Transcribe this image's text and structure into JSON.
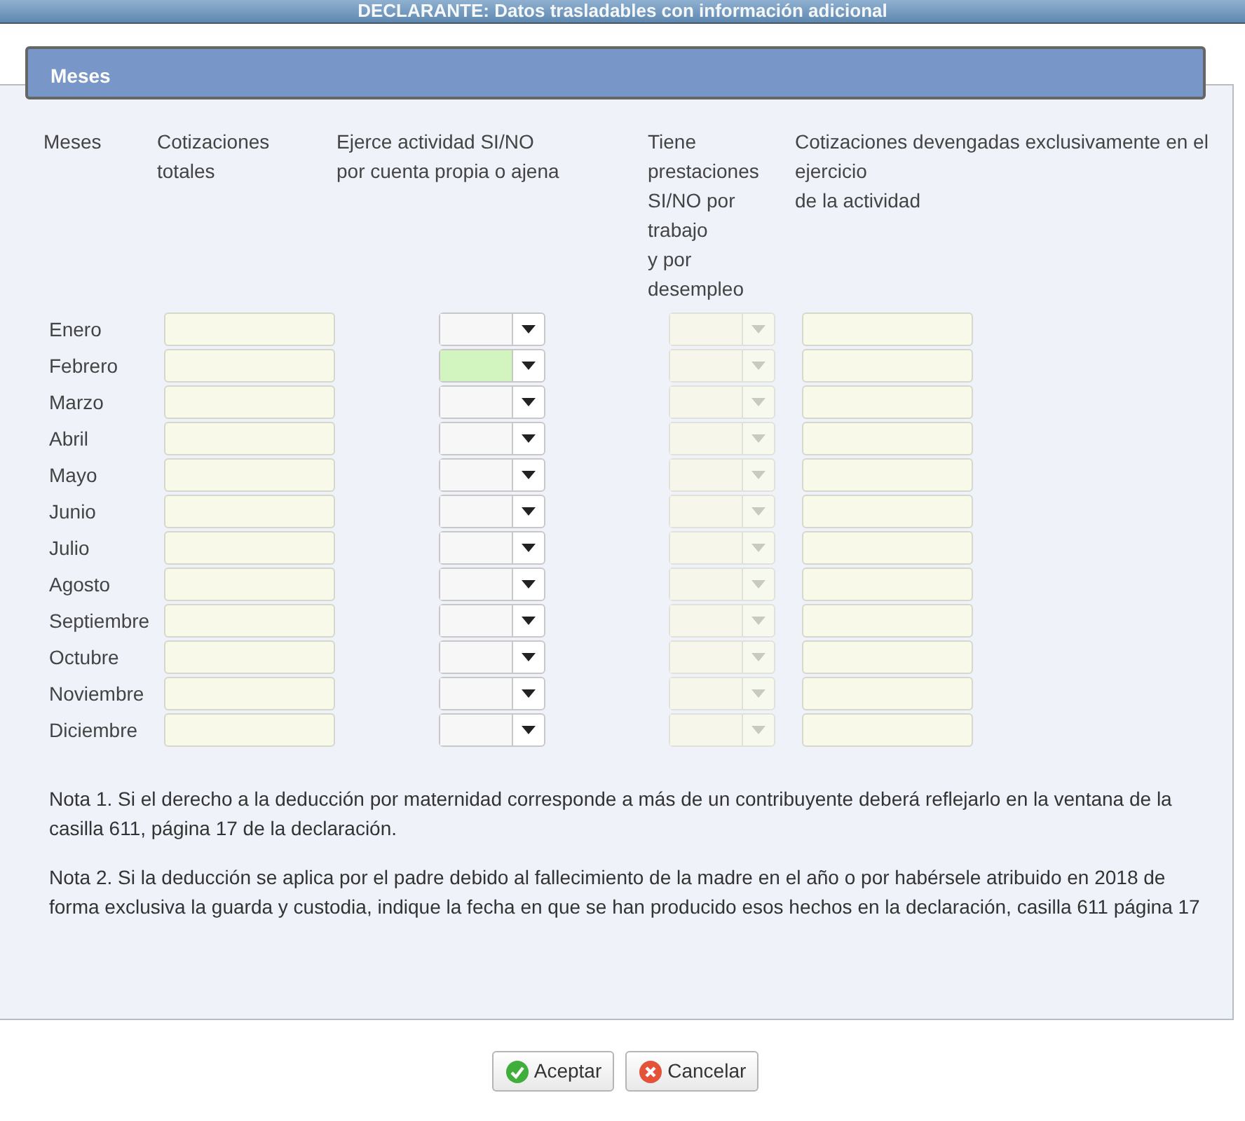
{
  "dialog": {
    "title": "DECLARANTE: Datos trasladables con información adicional"
  },
  "section": {
    "title": "Meses"
  },
  "columns": [
    "Meses",
    "Cotizaciones totales",
    "Ejerce actividad SI/NO\npor cuenta propia o ajena",
    "Tiene prestaciones SI/NO por trabajo\ny por desempleo",
    "Cotizaciones devengadas exclusivamente en el ejercicio\nde la actividad"
  ],
  "rows": [
    {
      "month": "Enero",
      "activity_highlighted": false,
      "benefits_disabled": true
    },
    {
      "month": "Febrero",
      "activity_highlighted": true,
      "benefits_disabled": true
    },
    {
      "month": "Marzo",
      "activity_highlighted": false,
      "benefits_disabled": true
    },
    {
      "month": "Abril",
      "activity_highlighted": false,
      "benefits_disabled": true
    },
    {
      "month": "Mayo",
      "activity_highlighted": false,
      "benefits_disabled": true
    },
    {
      "month": "Junio",
      "activity_highlighted": false,
      "benefits_disabled": true
    },
    {
      "month": "Julio",
      "activity_highlighted": false,
      "benefits_disabled": true
    },
    {
      "month": "Agosto",
      "activity_highlighted": false,
      "benefits_disabled": true
    },
    {
      "month": "Septiembre",
      "activity_highlighted": false,
      "benefits_disabled": true
    },
    {
      "month": "Octubre",
      "activity_highlighted": false,
      "benefits_disabled": true
    },
    {
      "month": "Noviembre",
      "activity_highlighted": false,
      "benefits_disabled": true
    },
    {
      "month": "Diciembre",
      "activity_highlighted": false,
      "benefits_disabled": true
    }
  ],
  "notes": [
    "Nota 1. Si el derecho a la deducción por maternidad corresponde a más de un contribuyente deberá reflejarlo en la ventana de la casilla 611, página 17 de la declaración.",
    "Nota 2. Si la deducción se aplica por el padre debido al fallecimiento de la madre en el año o por habérsele atribuido en 2018 de forma exclusiva la guarda y custodia, indique la fecha en que se han producido esos hechos en la declaración, casilla 611 página 17"
  ],
  "buttons": [
    {
      "label": "Aceptar",
      "kind": "ok"
    },
    {
      "label": "Cancelar",
      "kind": "cancel"
    }
  ]
}
